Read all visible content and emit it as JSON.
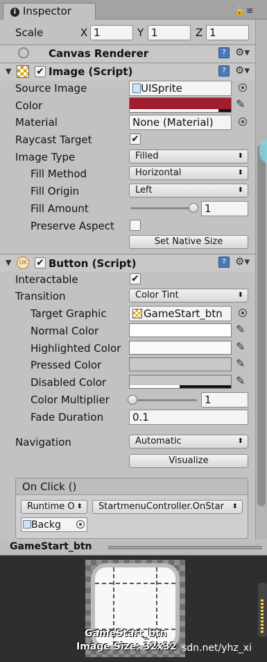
{
  "tab": {
    "title": "Inspector"
  },
  "transform": {
    "scale_label": "Scale",
    "x_label": "X",
    "x": "1",
    "y_label": "Y",
    "y": "1",
    "z_label": "Z",
    "z": "1"
  },
  "canvas_renderer": {
    "title": "Canvas Renderer"
  },
  "image": {
    "title": "Image (Script)",
    "source_image_label": "Source Image",
    "source_image": "UISprite",
    "color_label": "Color",
    "color": "#a01c2e",
    "material_label": "Material",
    "material": "None (Material)",
    "raycast_label": "Raycast Target",
    "image_type_label": "Image Type",
    "image_type": "Filled",
    "fill_method_label": "Fill Method",
    "fill_method": "Horizontal",
    "fill_origin_label": "Fill Origin",
    "fill_origin": "Left",
    "fill_amount_label": "Fill Amount",
    "fill_amount": "1",
    "preserve_label": "Preserve Aspect",
    "native_size_button": "Set Native Size"
  },
  "button": {
    "title": "Button (Script)",
    "interactable_label": "Interactable",
    "transition_label": "Transition",
    "transition": "Color Tint",
    "target_graphic_label": "Target Graphic",
    "target_graphic": "GameStart_btn",
    "normal_label": "Normal Color",
    "highlighted_label": "Highlighted Color",
    "pressed_label": "Pressed Color",
    "disabled_label": "Disabled Color",
    "multiplier_label": "Color Multiplier",
    "multiplier": "1",
    "fade_label": "Fade Duration",
    "fade": "0.1",
    "navigation_label": "Navigation",
    "navigation": "Automatic",
    "visualize_button": "Visualize"
  },
  "onclick": {
    "title": "On Click ()",
    "runtime": "Runtime O",
    "function": "StartmenuController.OnStar",
    "object": "Backg"
  },
  "preview": {
    "title": "GameStart_btn",
    "caption_name": "GameStart_btn",
    "caption_size": "Image Size: 32x32",
    "watermark": "sdn.net/yhz_xi"
  },
  "colors": {
    "accent_red": "#a01c2e",
    "unity_blue": "#4c79b8"
  }
}
